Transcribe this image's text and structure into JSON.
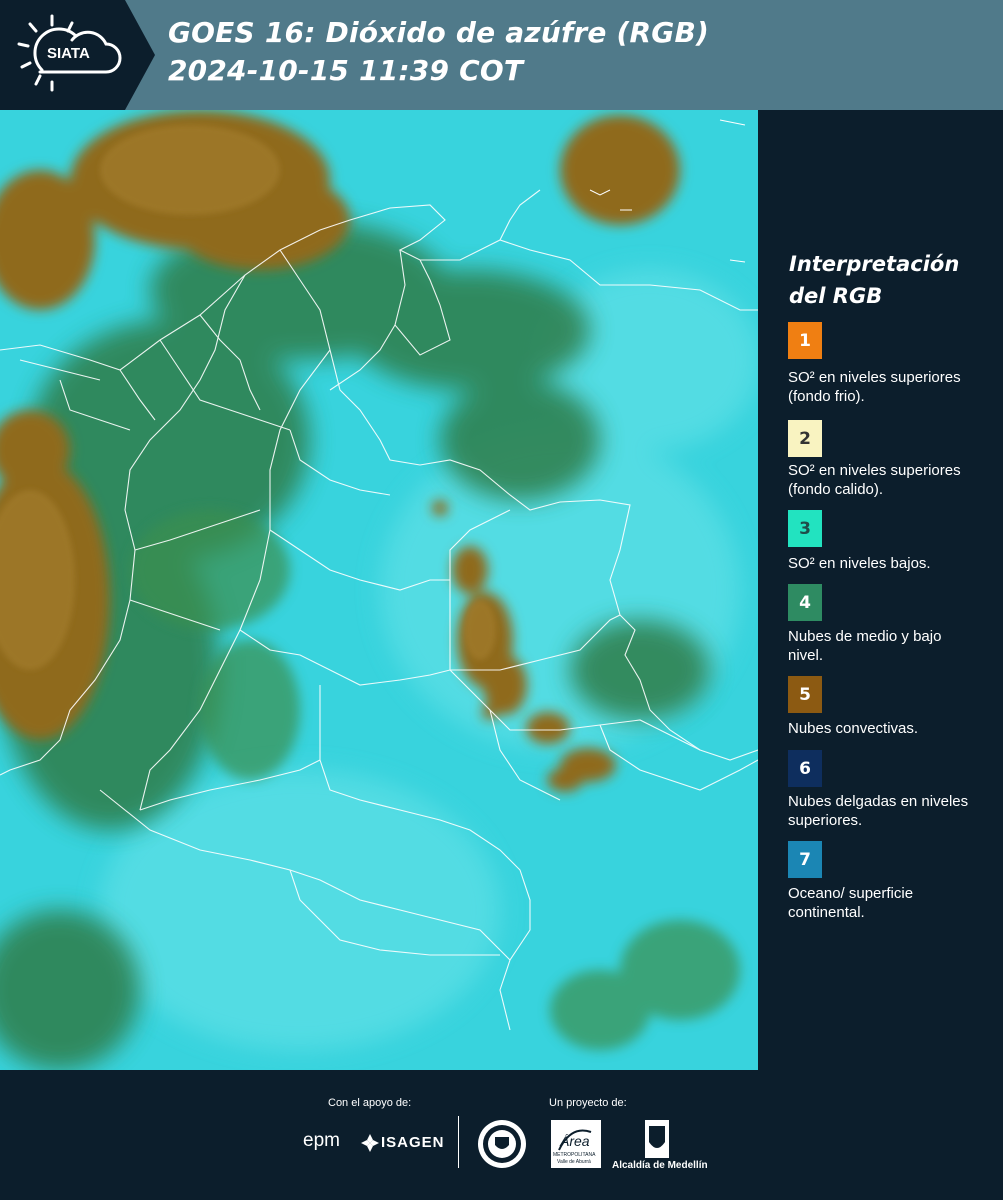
{
  "header": {
    "logo_text": "SIATA",
    "title_line1": "GOES 16: Dióxido de azúfre (RGB)",
    "title_line2": " 2024-10-15 11:39 COT"
  },
  "legend": {
    "title_line1": "Interpretación",
    "title_line2": "del RGB",
    "items": [
      {
        "number": "1",
        "color": "#f07f12",
        "text": "SO² en niveles superiores (fondo frio)."
      },
      {
        "number": "2",
        "color": "#f9f3c1",
        "text": "SO² en niveles superiores (fondo calido)."
      },
      {
        "number": "3",
        "color": "#22e3c0",
        "text": "SO² en niveles bajos."
      },
      {
        "number": "4",
        "color": "#2e8b62",
        "text": "Nubes de medio y bajo nivel."
      },
      {
        "number": "5",
        "color": "#8c5a12",
        "text": "Nubes convectivas."
      },
      {
        "number": "6",
        "color": "#0e2e5e",
        "text": "Nubes delgadas en niveles superiores."
      },
      {
        "number": "7",
        "color": "#1b86b4",
        "text": "Oceano/ superficie continental."
      }
    ]
  },
  "footer": {
    "support_label": "Con el apoyo de:",
    "project_label": "Un proyecto de:",
    "epm_text": "epm",
    "isagen_text": "ISAGEN",
    "area_text": "Área",
    "area_sub1": "METROPOLITANA",
    "area_sub2": "Valle de Aburrá",
    "alcaldia_text": "Alcaldía de Medellín"
  },
  "colors": {
    "header_bg": "#507a8a",
    "dark_bg": "#0c1e2c",
    "cloud_cyan": "#36d2dc",
    "convective_brown": "#8f6a1f",
    "low_cloud_green": "#2f7d4a"
  }
}
